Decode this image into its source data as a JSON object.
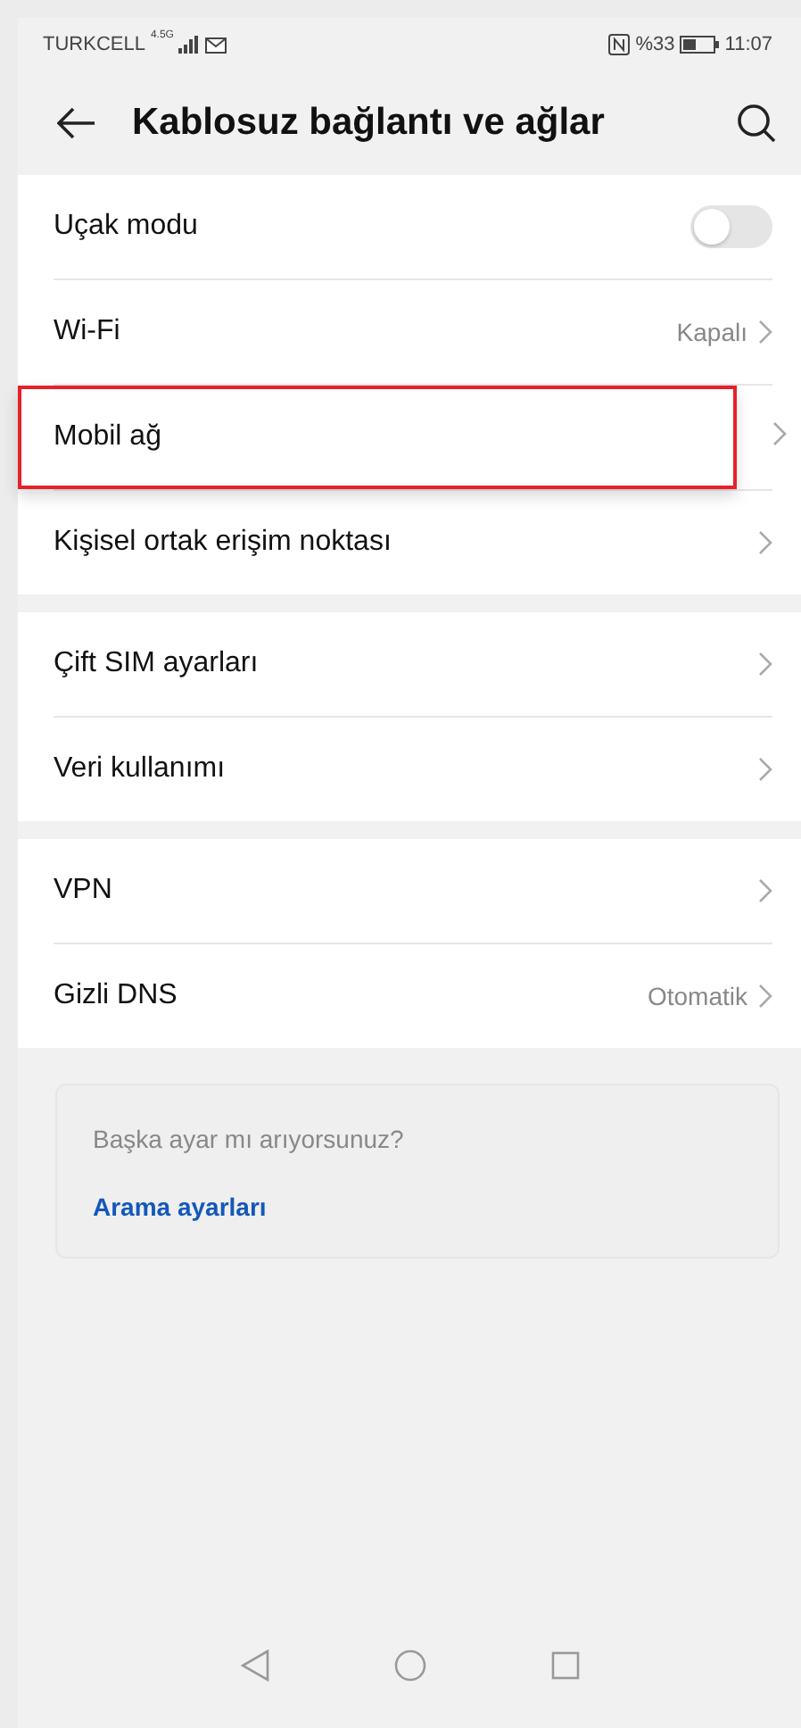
{
  "status_bar": {
    "carrier": "TURKCELL",
    "network": "4.5G",
    "battery": "%33",
    "time": "11:07"
  },
  "header": {
    "title": "Kablosuz bağlantı ve ağlar"
  },
  "sections": [
    {
      "items": [
        {
          "kind": "toggle",
          "label": "Uçak modu",
          "on": false,
          "highlighted": false
        },
        {
          "kind": "link",
          "label": "Wi-Fi",
          "value": "Kapalı",
          "highlighted": false
        },
        {
          "kind": "link",
          "label": "Mobil ağ",
          "highlighted": true
        },
        {
          "kind": "link",
          "label": "Kişisel ortak erişim noktası",
          "highlighted": false
        }
      ]
    },
    {
      "items": [
        {
          "kind": "link",
          "label": "Çift SIM ayarları",
          "highlighted": false
        },
        {
          "kind": "link",
          "label": "Veri kullanımı",
          "highlighted": false
        }
      ]
    },
    {
      "items": [
        {
          "kind": "link",
          "label": "VPN",
          "highlighted": false
        },
        {
          "kind": "link",
          "label": "Gizli DNS",
          "value": "Otomatik",
          "highlighted": false
        }
      ]
    }
  ],
  "suggestion": {
    "question": "Başka ayar mı arıyorsunuz?",
    "link": "Arama ayarları"
  }
}
